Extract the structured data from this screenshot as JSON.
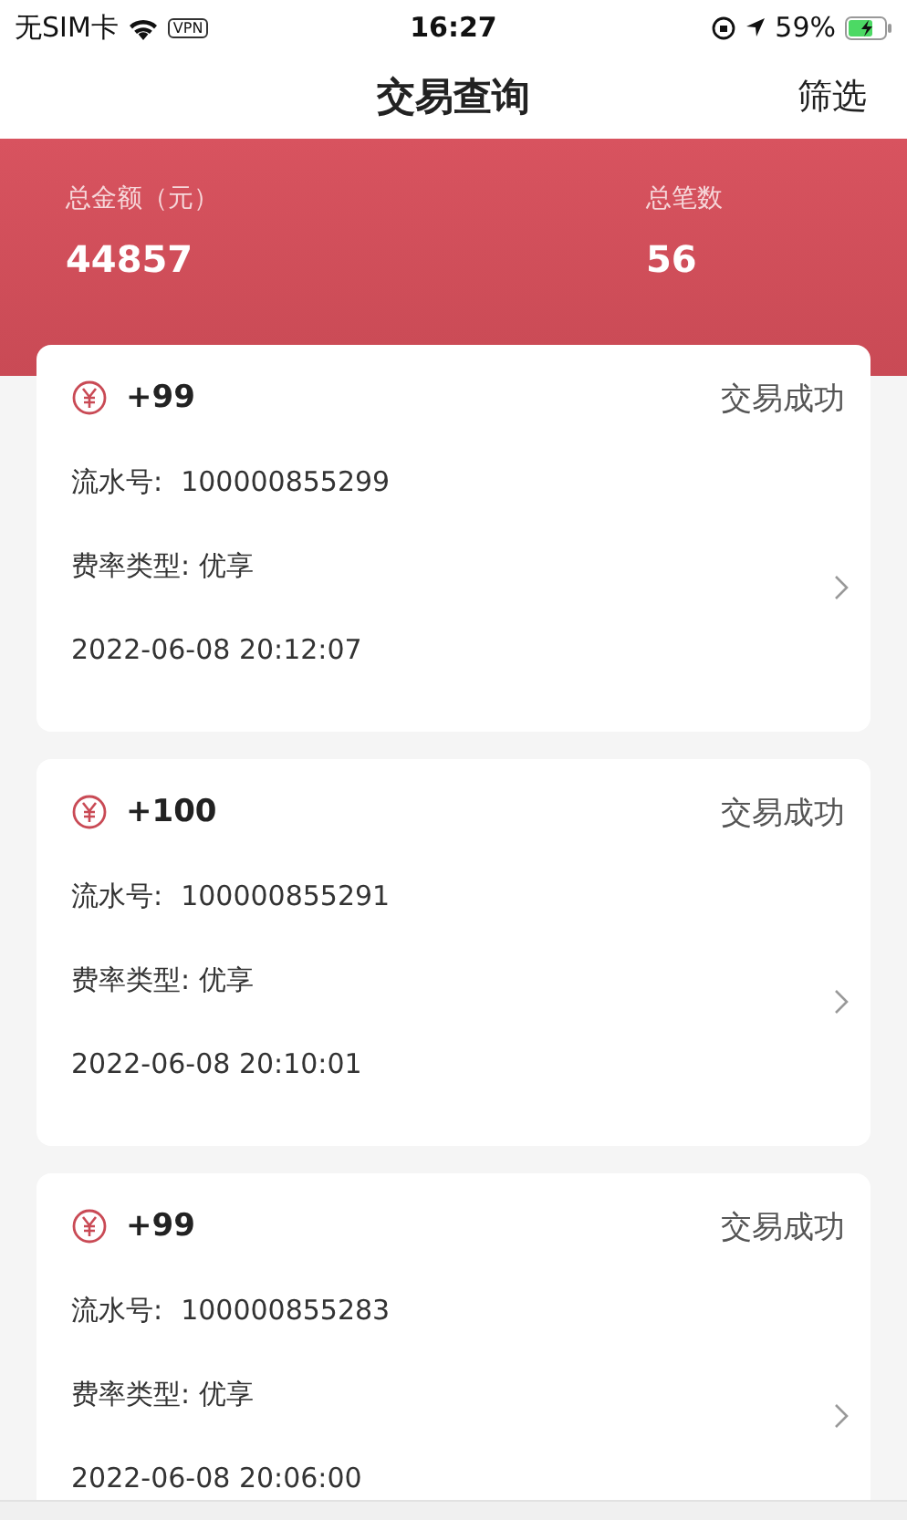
{
  "status_bar": {
    "carrier": "无SIM卡",
    "vpn": "VPN",
    "time": "16:27",
    "battery": "59%"
  },
  "nav": {
    "title": "交易查询",
    "action": "筛选"
  },
  "summary": {
    "amount_label": "总金额（元）",
    "amount": "44857",
    "count_label": "总笔数",
    "count": "56"
  },
  "transactions": [
    {
      "amount": "+99",
      "status": "交易成功",
      "serial_label": "流水号:",
      "serial": "100000855299",
      "rate": "费率类型: 优享",
      "time": "2022-06-08 20:12:07"
    },
    {
      "amount": "+100",
      "status": "交易成功",
      "serial_label": "流水号:",
      "serial": "100000855291",
      "rate": "费率类型: 优享",
      "time": "2022-06-08 20:10:01"
    },
    {
      "amount": "+99",
      "status": "交易成功",
      "serial_label": "流水号:",
      "serial": "100000855283",
      "rate": "费率类型: 优享",
      "time": "2022-06-08 20:06:00"
    }
  ]
}
